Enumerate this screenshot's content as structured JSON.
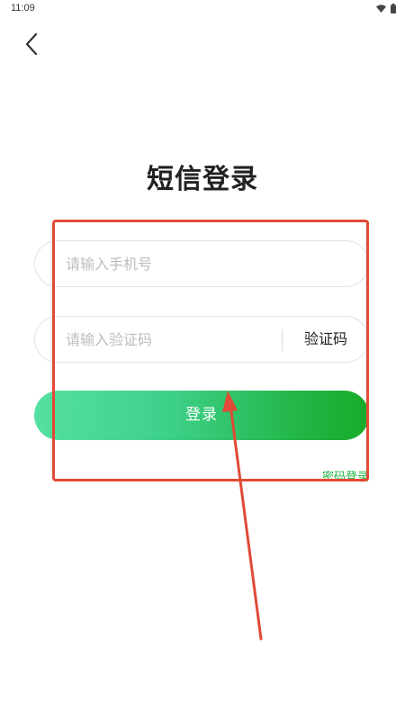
{
  "status_bar": {
    "time": "11:09"
  },
  "navigation": {
    "back_icon": "chevron-left-icon"
  },
  "page": {
    "title": "短信登录"
  },
  "form": {
    "phone_placeholder": "请输入手机号",
    "code_placeholder": "请输入验证码",
    "get_code_label": "验证码",
    "login_label": "登录",
    "password_login_label": "密码登录"
  },
  "colors": {
    "accent_green": "#22b545",
    "gradient_start": "#55e0a0",
    "annotation_red": "#e04a36",
    "placeholder_gray": "#bdbdbd"
  }
}
